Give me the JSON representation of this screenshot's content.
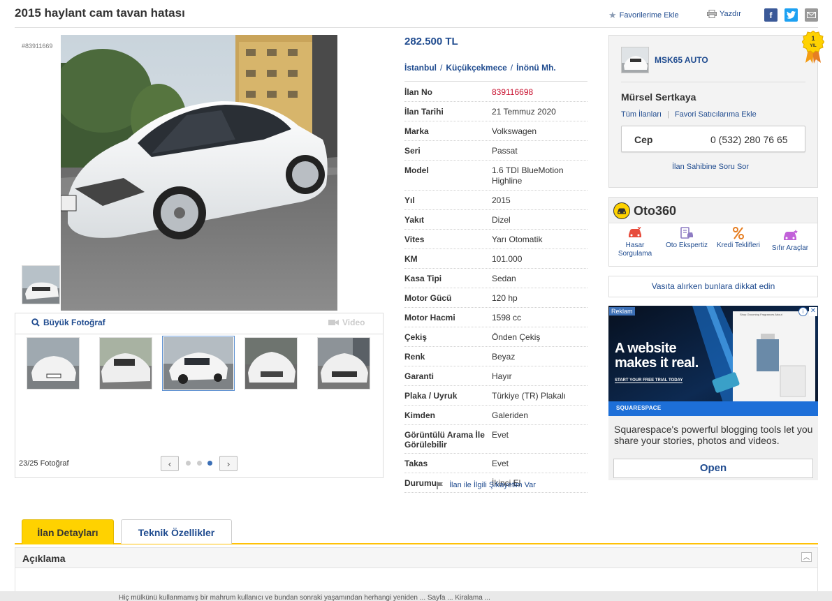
{
  "header": {
    "title": "2015 haylant cam tavan hatası",
    "favorites_label": "Favorilerime Ekle",
    "print_label": "Yazdır"
  },
  "gallery": {
    "ad_no_small": "#83911669",
    "big_photo_label": "Büyük Fotoğraf",
    "video_label": "Video",
    "photo_count": "23/25 Fotoğraf"
  },
  "listing": {
    "price": "282.500 TL",
    "location": [
      "İstanbul",
      "Küçükçekmece",
      "İnönü Mh."
    ],
    "specs": [
      {
        "key": "İlan No",
        "value": "839116698"
      },
      {
        "key": "İlan Tarihi",
        "value": "21 Temmuz 2020"
      },
      {
        "key": "Marka",
        "value": "Volkswagen"
      },
      {
        "key": "Seri",
        "value": "Passat"
      },
      {
        "key": "Model",
        "value": "1.6 TDI BlueMotion Highline"
      },
      {
        "key": "Yıl",
        "value": "2015"
      },
      {
        "key": "Yakıt",
        "value": "Dizel"
      },
      {
        "key": "Vites",
        "value": "Yarı Otomatik"
      },
      {
        "key": "KM",
        "value": "101.000"
      },
      {
        "key": "Kasa Tipi",
        "value": "Sedan"
      },
      {
        "key": "Motor Gücü",
        "value": "120 hp"
      },
      {
        "key": "Motor Hacmi",
        "value": "1598 cc"
      },
      {
        "key": "Çekiş",
        "value": "Önden Çekiş"
      },
      {
        "key": "Renk",
        "value": "Beyaz"
      },
      {
        "key": "Garanti",
        "value": "Hayır"
      },
      {
        "key": "Plaka / Uyruk",
        "value": "Türkiye (TR) Plakalı"
      },
      {
        "key": "Kimden",
        "value": "Galeriden"
      },
      {
        "key": "Görüntülü Arama İle Görülebilir",
        "value": "Evet"
      },
      {
        "key": "Takas",
        "value": "Evet"
      },
      {
        "key": "Durumu",
        "value": "İkinci El"
      }
    ],
    "complaint_label": "İlan ile İlgili Şikayetim Var"
  },
  "seller": {
    "store_name": "MSK65 AUTO",
    "name": "Mürsel Sertkaya",
    "all_ads_label": "Tüm İlanları",
    "favorite_seller_label": "Favori Satıcılarıma Ekle",
    "phone_label": "Cep",
    "phone_number": "0 (532) 280 76 65",
    "ask_label": "İlan Sahibine Soru Sor",
    "badge_text": "1 YIL"
  },
  "oto360": {
    "title": "Oto360",
    "items": [
      "Hasar Sorgulama",
      "Oto Ekspertiz",
      "Kredi Teklifleri",
      "Sıfır Araçlar"
    ]
  },
  "warning_label": "Vasıta alırken bunlara dikkat edin",
  "ad": {
    "tag": "Reklam",
    "headline_1": "A website",
    "headline_2": "makes it real.",
    "cta_small": "START YOUR FREE TRIAL TODAY",
    "brand": "SQUARESPACE",
    "text": "Squarespace's powerful blogging tools let you share your stories, photos and videos.",
    "button": "Open"
  },
  "tabs": {
    "details": "İlan Detayları",
    "technical": "Teknik Özellikler"
  },
  "description": {
    "title": "Açıklama"
  },
  "footer_note": "Hiç mülkünü kullanmamış bir mahrum kullanıcı ve bundan sonraki yaşamından herhangi yeniden ... Sayfa ... Kiralama ..."
}
